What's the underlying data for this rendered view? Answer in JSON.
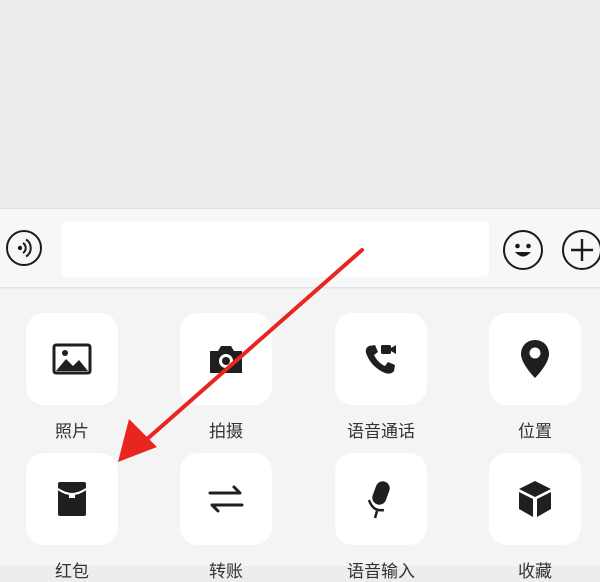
{
  "input_bar": {
    "voice_icon": "voice-wave-icon",
    "text_value": "",
    "emoji_icon": "smiley-icon",
    "more_icon": "plus-icon"
  },
  "tools": [
    {
      "label": "照片",
      "icon": "image-icon"
    },
    {
      "label": "拍摄",
      "icon": "camera-icon"
    },
    {
      "label": "语音通话",
      "icon": "phone-video-icon"
    },
    {
      "label": "位置",
      "icon": "location-pin-icon"
    },
    {
      "label": "红包",
      "icon": "red-packet-icon"
    },
    {
      "label": "转账",
      "icon": "transfer-arrows-icon"
    },
    {
      "label": "语音输入",
      "icon": "microphone-icon"
    },
    {
      "label": "收藏",
      "icon": "cube-icon"
    }
  ],
  "annotation": {
    "arrow_color": "#e8261f",
    "points_to": "红包"
  },
  "colors": {
    "icon": "#1f1f1f",
    "tile": "#ffffff",
    "panel": "#f4f4f4"
  }
}
